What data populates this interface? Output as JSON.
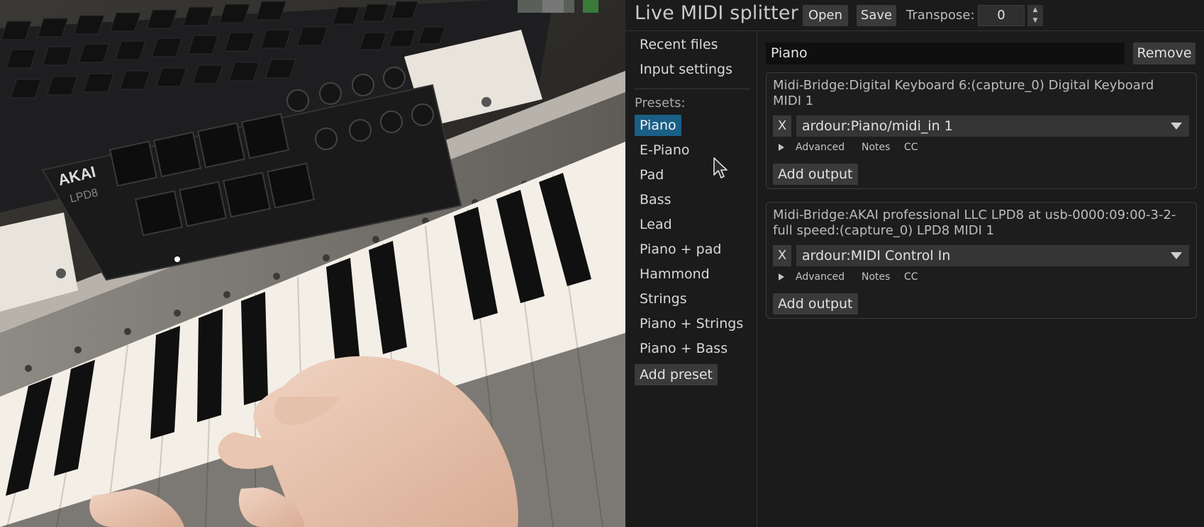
{
  "header": {
    "title": "Live MIDI splitter",
    "open_label": "Open",
    "save_label": "Save",
    "transpose_label": "Transpose:",
    "transpose_value": "0"
  },
  "sidebar": {
    "recent_files": "Recent files",
    "input_settings": "Input settings",
    "presets_label": "Presets:",
    "presets": [
      "Piano",
      "E-Piano",
      "Pad",
      "Bass",
      "Lead",
      "Piano + pad",
      "Hammond",
      "Strings",
      "Piano + Strings",
      "Piano + Bass"
    ],
    "selected_preset": "Piano",
    "add_preset_label": "Add preset"
  },
  "main": {
    "preset_name": "Piano",
    "remove_label": "Remove",
    "inputs": [
      {
        "title": "Midi-Bridge:Digital Keyboard 6:(capture_0) Digital Keyboard MIDI 1",
        "remove_output_label": "X",
        "output": "ardour:Piano/midi_in 1",
        "advanced_label": "Advanced",
        "notes_label": "Notes",
        "cc_label": "CC",
        "add_output_label": "Add output"
      },
      {
        "title": "Midi-Bridge:AKAI professional LLC LPD8 at usb-0000:09:00-3-2-full speed:(capture_0) LPD8 MIDI 1",
        "remove_output_label": "X",
        "output": "ardour:MIDI Control In",
        "advanced_label": "Advanced",
        "notes_label": "Notes",
        "cc_label": "CC",
        "add_output_label": "Add output"
      }
    ]
  },
  "photo": {
    "brand_text": "AKAI",
    "model_text": "LPD8"
  },
  "colors": {
    "selected_preset_bg": "#1a5f86",
    "panel_bg": "#1b1b1b",
    "button_bg": "#3a3a3a"
  },
  "icons": {
    "cursor": "mouse-pointer-icon",
    "dropdown": "chevron-down-icon",
    "advanced": "triangle-right-icon"
  }
}
